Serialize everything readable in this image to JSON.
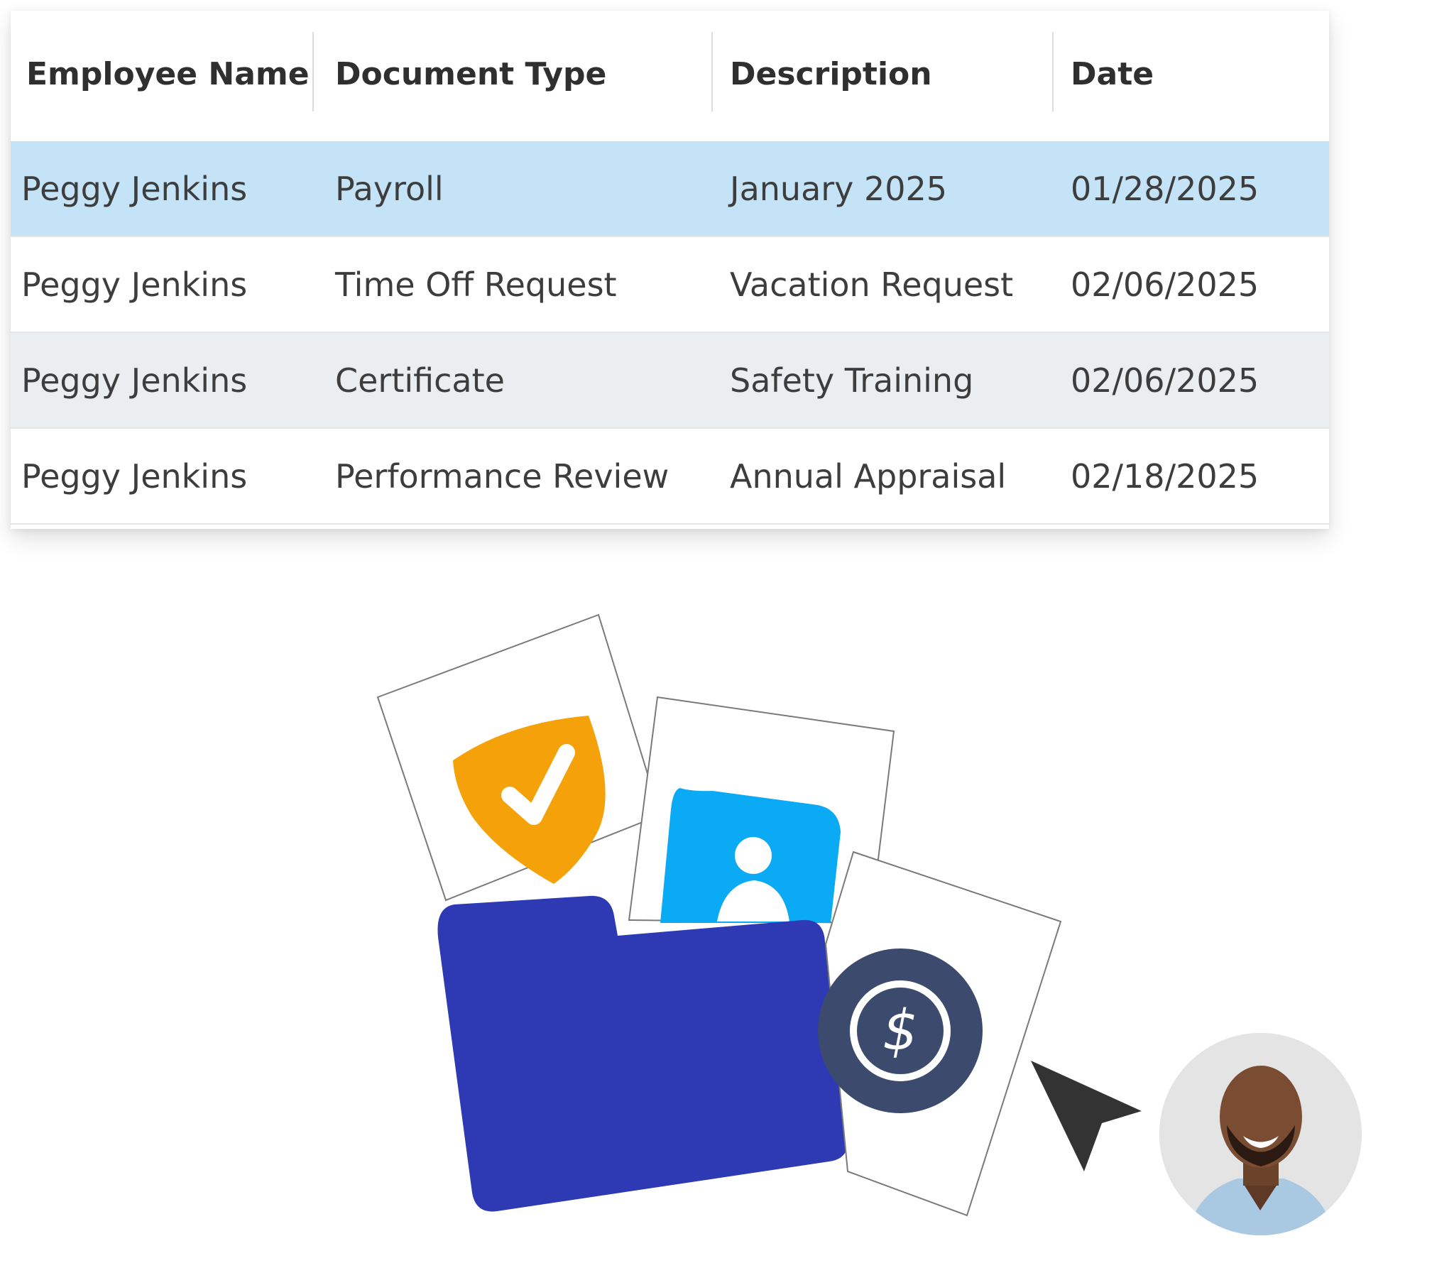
{
  "table": {
    "columns": [
      "Employee Name",
      "Document Type",
      "Description",
      "Date"
    ],
    "rows": [
      {
        "employee": "Peggy Jenkins",
        "type": "Payroll",
        "description": "January 2025",
        "date": "01/28/2025"
      },
      {
        "employee": "Peggy Jenkins",
        "type": "Time Off Request",
        "description": "Vacation Request",
        "date": "02/06/2025"
      },
      {
        "employee": "Peggy Jenkins",
        "type": "Certificate",
        "description": "Safety Training",
        "date": "02/06/2025"
      },
      {
        "employee": "Peggy Jenkins",
        "type": "Performance Review",
        "description": "Annual Appraisal",
        "date": "02/18/2025"
      }
    ],
    "selected_row": 0
  },
  "colors": {
    "selected_row": "#c4e3f7",
    "alt_row": "#ebeef0",
    "folder": "#2e3ab4",
    "shield": "#f5a10a",
    "contact_card": "#0aaaf5",
    "dollar_badge": "#3c4a6e",
    "cursor": "#333333"
  },
  "icons": [
    "shield-check-icon",
    "contact-card-icon",
    "dollar-coin-icon",
    "folder-icon",
    "cursor-arrow-icon",
    "avatar"
  ]
}
